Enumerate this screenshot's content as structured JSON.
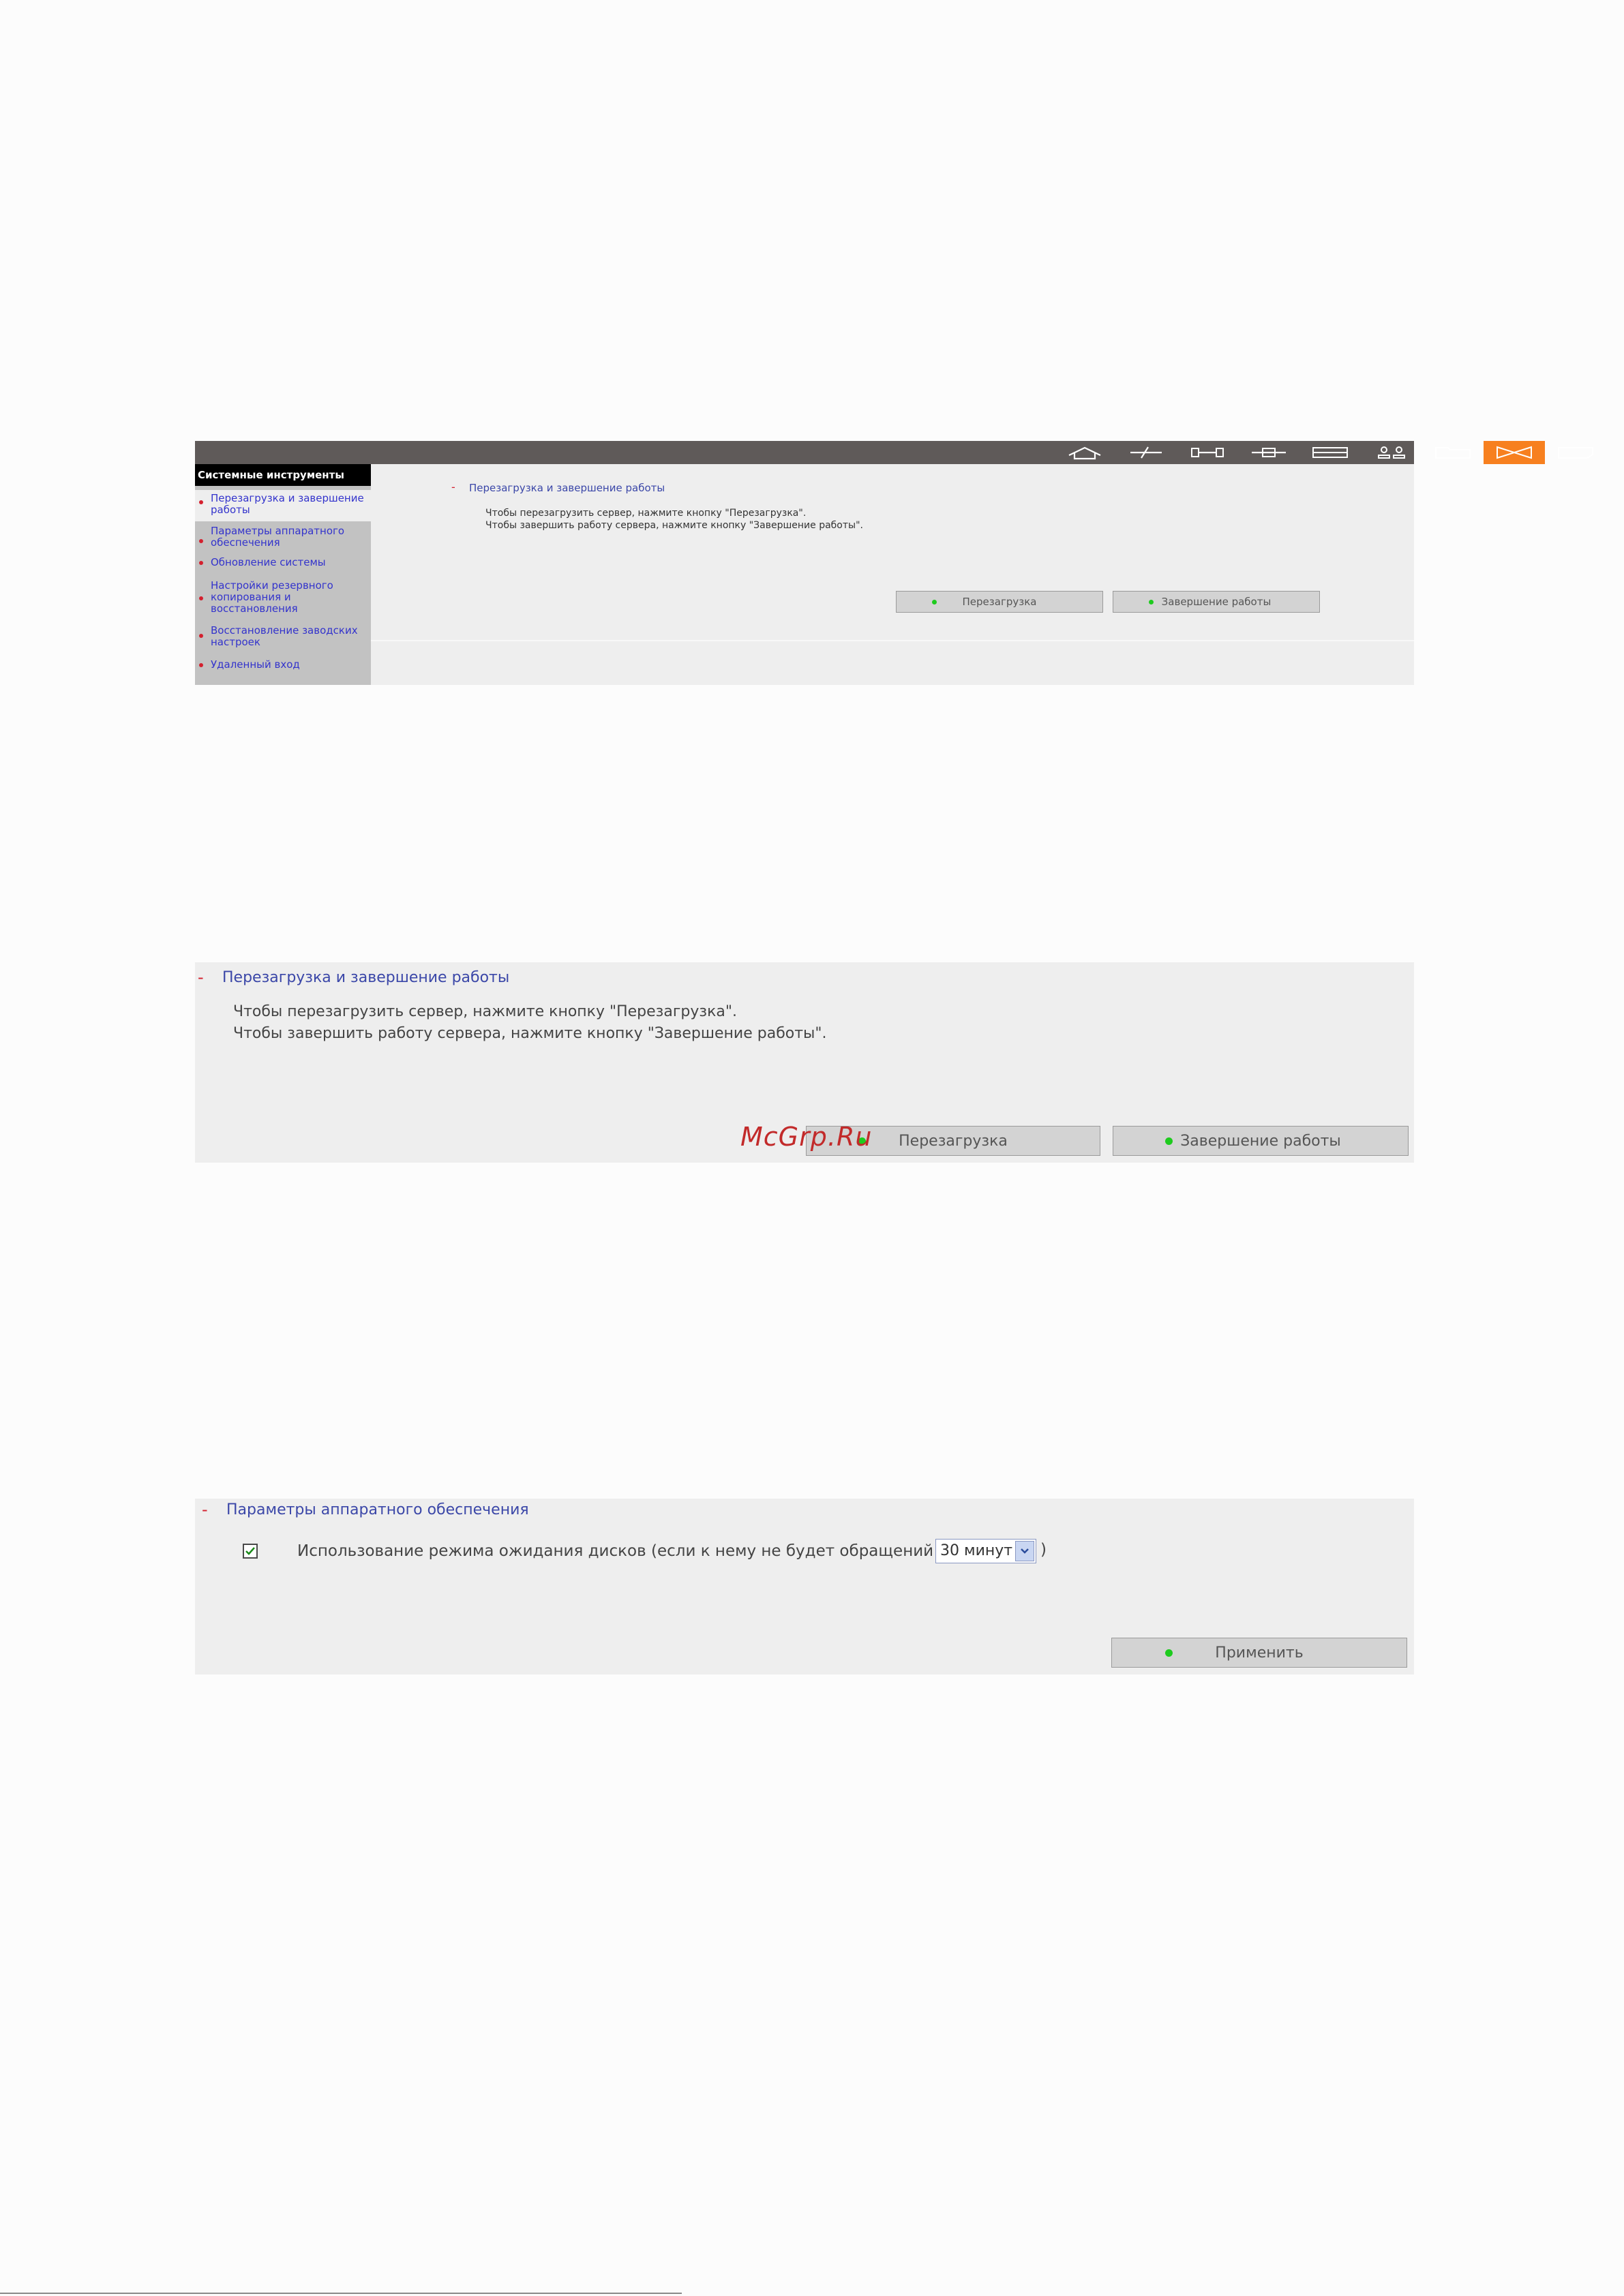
{
  "shot1": {
    "nav_icons": [
      "home-icon",
      "quick-setup-icon",
      "system-settings-icon",
      "network-icon",
      "device-icon",
      "users-icon",
      "shares-icon",
      "system-tools-icon",
      "statistics-icon"
    ],
    "active_nav": "system-tools-icon",
    "sidebar": {
      "title": "Системные инструменты",
      "items": [
        {
          "label": "Перезагрузка и завершение работы",
          "selected": true
        },
        {
          "label": "Параметры аппаратного обеспечения"
        },
        {
          "label": "Обновление системы"
        },
        {
          "label": "Настройки резервного копирования и восстановления"
        },
        {
          "label": "Восстановление заводских настроек"
        },
        {
          "label": "Удаленный вход"
        }
      ]
    },
    "section": {
      "title": "Перезагрузка и завершение работы",
      "lines": [
        "Чтобы перезагрузить сервер, нажмите кнопку \"Перезагрузка\".",
        "Чтобы завершить работу сервера, нажмите кнопку \"Завершение работы\"."
      ],
      "buttons": {
        "restart": "Перезагрузка",
        "shutdown": "Завершение работы"
      }
    }
  },
  "shot2": {
    "section": {
      "title": "Перезагрузка и завершение работы",
      "lines": [
        "Чтобы перезагрузить сервер, нажмите кнопку \"Перезагрузка\".",
        "Чтобы завершить работу сервера, нажмите кнопку \"Завершение работы\"."
      ],
      "buttons": {
        "restart": "Перезагрузка",
        "shutdown": "Завершение работы"
      }
    },
    "watermark": "McGrp.Ru"
  },
  "shot3": {
    "section": {
      "title": "Параметры аппаратного обеспечения",
      "option": "Использование режима ожидания дисков (если к нему не будет обращений в течение",
      "checked": true,
      "select_value": "30 минут",
      "closing": ")",
      "apply": "Применить"
    }
  },
  "colors": {
    "accent": "#f7801f",
    "topbar": "#5f5a59",
    "link": "#3b47a8",
    "bullet": "#d4202e",
    "status_dot": "#1ecb1e"
  }
}
